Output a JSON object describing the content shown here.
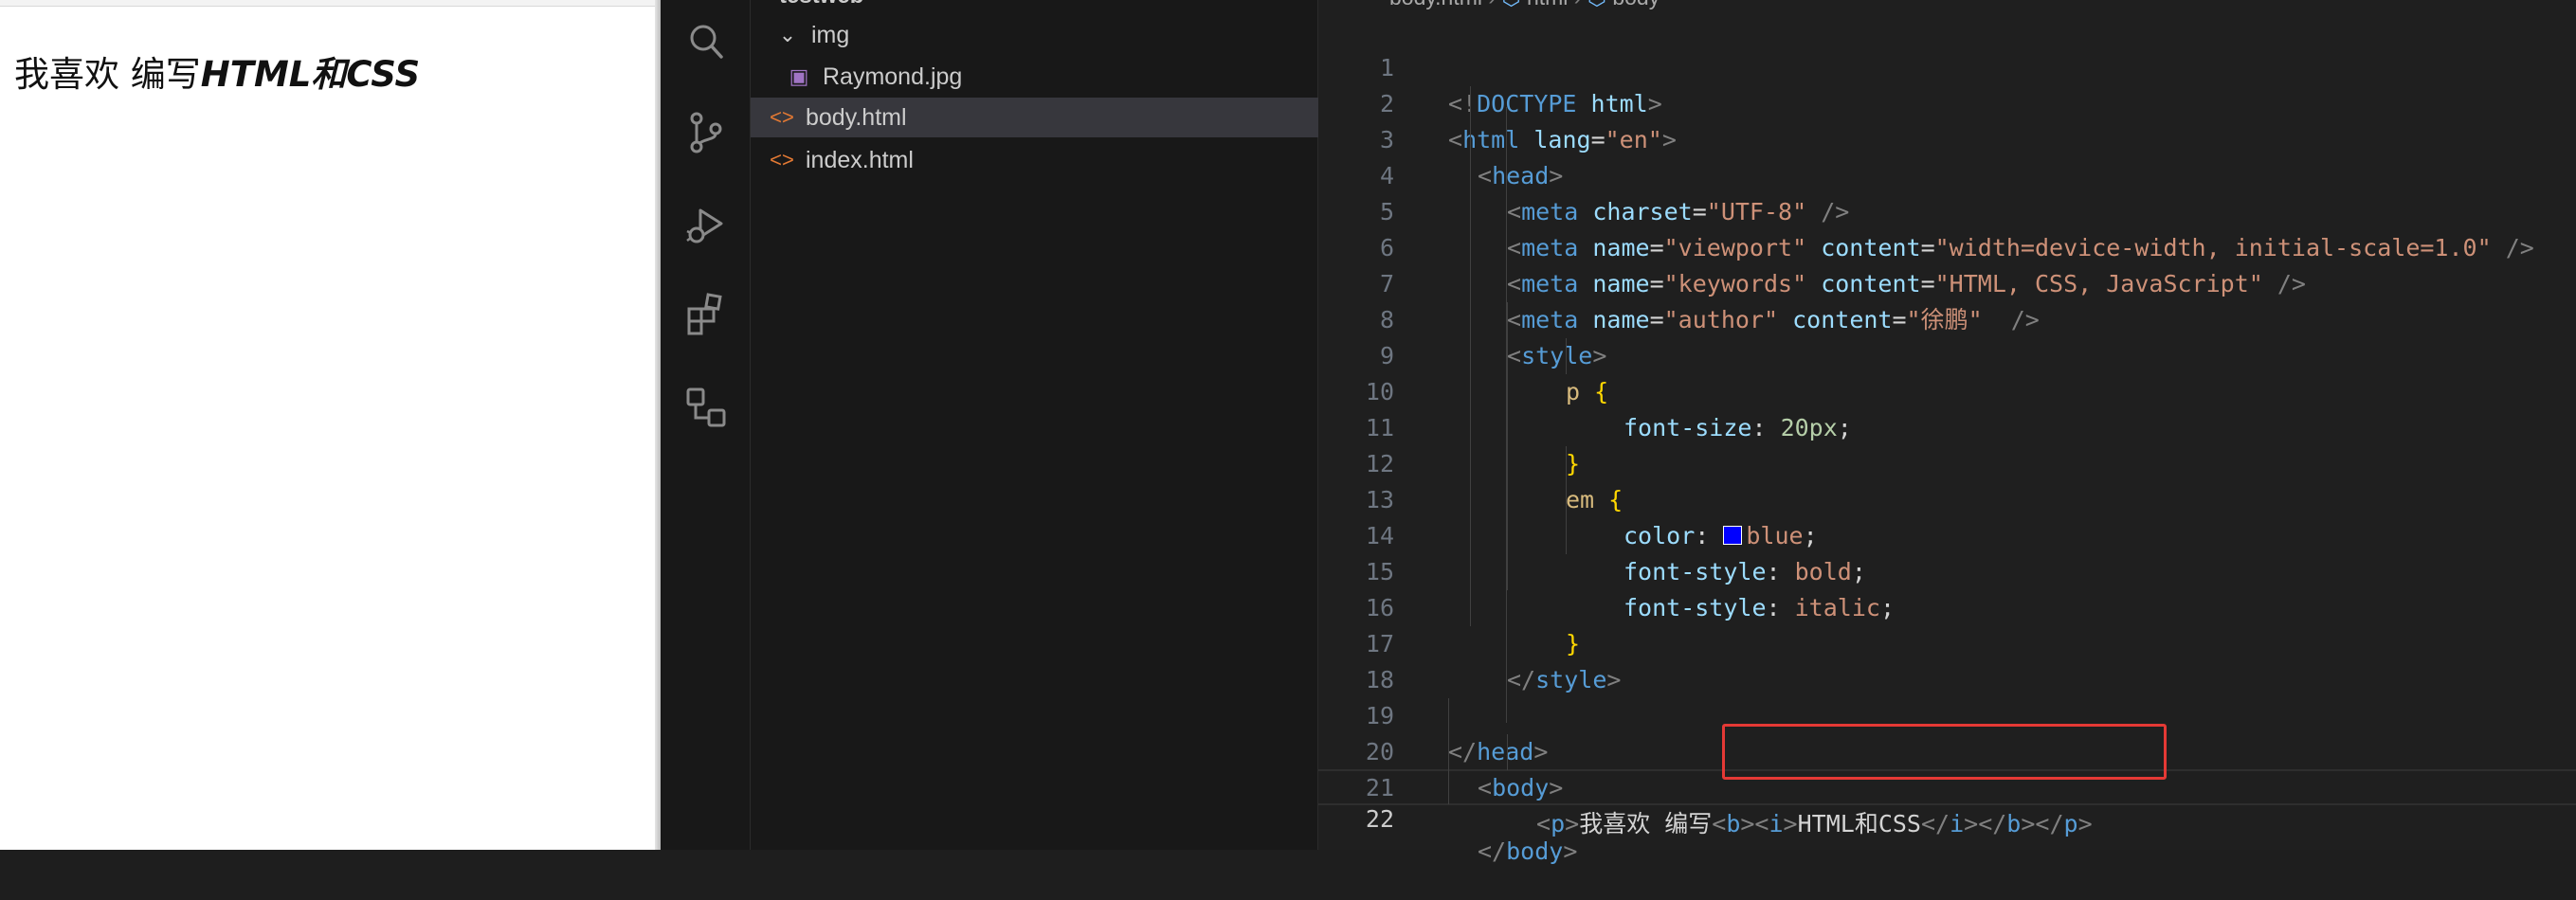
{
  "preview": {
    "text_plain": "我喜欢 编写",
    "text_bold_italic": "HTML和CSS"
  },
  "activity_bar": {
    "items": [
      {
        "icon": "search-icon"
      },
      {
        "icon": "source-control-icon"
      },
      {
        "icon": "run-debug-icon"
      },
      {
        "icon": "extensions-icon"
      },
      {
        "icon": "remote-explorer-icon"
      }
    ]
  },
  "explorer": {
    "folder_header": "testweb",
    "items": [
      {
        "label": "img",
        "type": "folder",
        "icon": "chevron-down-icon"
      },
      {
        "label": "Raymond.jpg",
        "type": "image",
        "icon": "image-file-icon"
      },
      {
        "label": "body.html",
        "type": "html",
        "icon": "html-file-icon",
        "selected": true
      },
      {
        "label": "index.html",
        "type": "html",
        "icon": "html-file-icon"
      }
    ]
  },
  "editor": {
    "breadcrumb": [
      "body.html",
      "html",
      "body"
    ],
    "current_line": 22,
    "lines": [
      {
        "n": "1"
      },
      {
        "n": "2"
      },
      {
        "n": "3"
      },
      {
        "n": "4"
      },
      {
        "n": "5"
      },
      {
        "n": "6"
      },
      {
        "n": "7"
      },
      {
        "n": "8"
      },
      {
        "n": "9"
      },
      {
        "n": "10"
      },
      {
        "n": "11"
      },
      {
        "n": "12"
      },
      {
        "n": "13"
      },
      {
        "n": "14"
      },
      {
        "n": "15"
      },
      {
        "n": "16"
      },
      {
        "n": "17"
      },
      {
        "n": "18"
      },
      {
        "n": "19"
      },
      {
        "n": "20"
      },
      {
        "n": "21"
      },
      {
        "n": "22"
      }
    ],
    "code": {
      "doctype": "DOCTYPE",
      "doctype_html": "html",
      "html_tag": "html",
      "lang_attr": "lang",
      "lang_val": "\"en\"",
      "head_tag": "head",
      "meta_tag": "meta",
      "charset_attr": "charset",
      "charset_val": "\"UTF-8\"",
      "name_attr": "name",
      "content_attr": "content",
      "viewport_val": "\"viewport\"",
      "viewport_content": "\"width=device-width, initial-scale=1.0\"",
      "keywords_val": "\"keywords\"",
      "keywords_content": "\"HTML, CSS, JavaScript\"",
      "author_val": "\"author\"",
      "author_content": "\"徐鹏\"",
      "style_tag": "style",
      "sel_p": "p",
      "prop_font_size": "font-size",
      "val_20px": "20px",
      "sel_em": "em",
      "prop_color": "color",
      "val_blue": "blue",
      "prop_font_style": "font-style",
      "val_bold": "bold",
      "val_italic": "italic",
      "body_tag": "body",
      "p_tag": "p",
      "p_text": "我喜欢 编写",
      "b_tag": "b",
      "i_tag": "i",
      "inner_text": "HTML和CSS"
    }
  },
  "colors": {
    "swatch_blue": "#0000ff",
    "highlight_box": "#e53935"
  }
}
